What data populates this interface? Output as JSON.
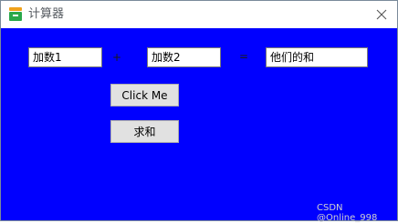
{
  "window": {
    "title": "计算器",
    "app_icon": "calculator-app-icon",
    "close_icon": "close-icon"
  },
  "form": {
    "addend1": "加数1",
    "plus_sign": "+",
    "addend2": "加数2",
    "equals_sign": "=",
    "sum": "他们的和"
  },
  "buttons": {
    "click_me": "Click Me",
    "sum": "求和"
  },
  "watermark": "CSDN @Online_998",
  "colors": {
    "client_background": "#0000ff",
    "button_face": "#e1e1e1",
    "icon_accent": "#2aa84a"
  }
}
